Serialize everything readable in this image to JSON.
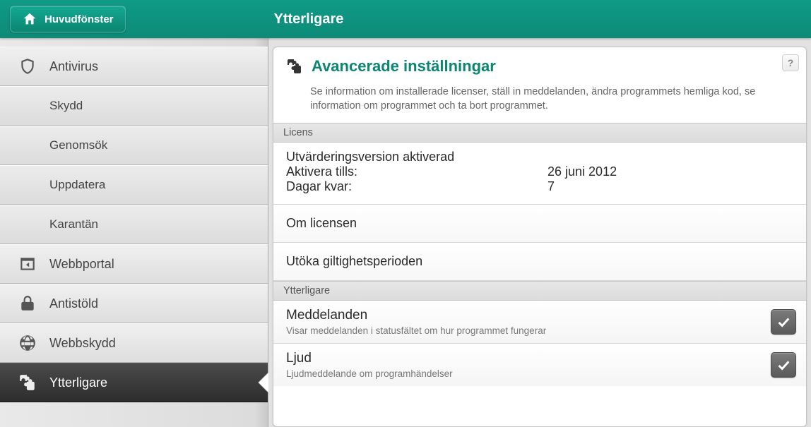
{
  "topbar": {
    "home_label": "Huvudfönster",
    "title": "Ytterligare"
  },
  "sidebar": {
    "items": [
      {
        "label": "Antivirus"
      },
      {
        "label": "Skydd"
      },
      {
        "label": "Genomsök"
      },
      {
        "label": "Uppdatera"
      },
      {
        "label": "Karantän"
      },
      {
        "label": "Webbportal"
      },
      {
        "label": "Antistöld"
      },
      {
        "label": "Webbskydd"
      },
      {
        "label": "Ytterligare"
      }
    ]
  },
  "panel": {
    "title": "Avancerade inställningar",
    "help_label": "?",
    "description": "Se information om installerade licenser, ställ in meddelanden, ändra programmets hemliga kod, se information om programmet och ta bort programmet.",
    "license": {
      "section_label": "Licens",
      "status": "Utvärderingsversion aktiverad",
      "active_until_label": "Aktivera tills:",
      "active_until_value": "26 juni 2012",
      "days_left_label": "Dagar kvar:",
      "days_left_value": "7",
      "about_license": "Om licensen",
      "extend_validity": "Utöka giltighetsperioden"
    },
    "additional": {
      "section_label": "Ytterligare",
      "notifications": {
        "title": "Meddelanden",
        "subtitle": "Visar meddelanden i statusfältet om hur programmet fungerar",
        "checked": true
      },
      "sound": {
        "title": "Ljud",
        "subtitle": "Ljudmeddelande om programhändelser",
        "checked": true
      }
    }
  }
}
